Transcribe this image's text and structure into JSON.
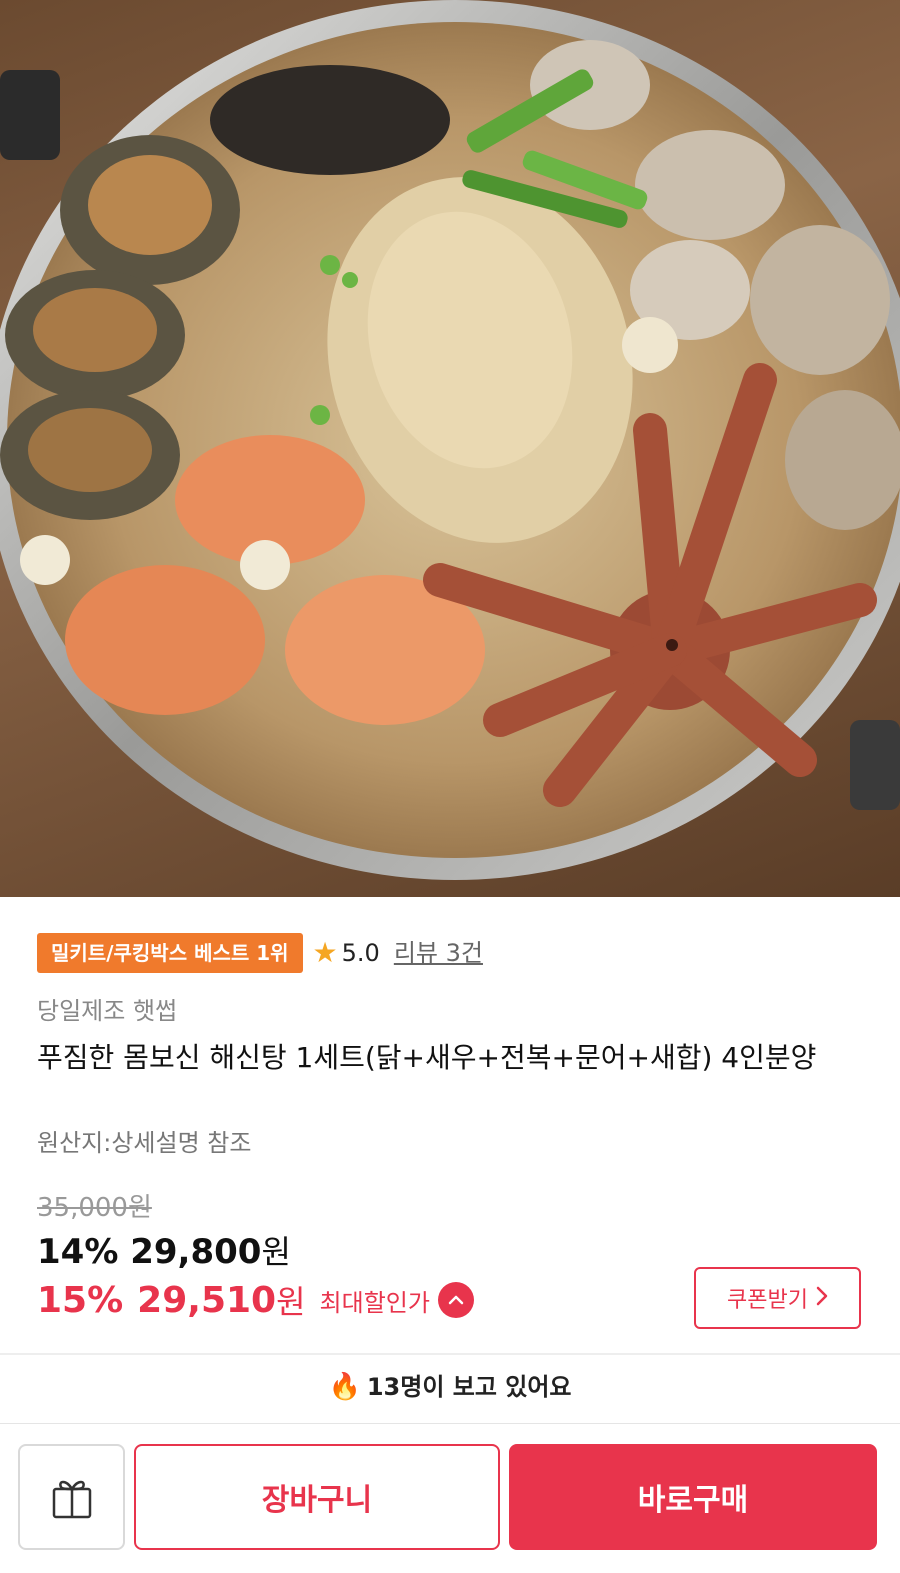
{
  "hero": {
    "image_description_icon": "seafood-hotpot-photo"
  },
  "product": {
    "best_badge": "밀키트/쿠킹박스 베스트 1위",
    "rating": "5.0",
    "review_link": "리뷰 3건",
    "brand": "당일제조 햇썹",
    "title": "푸짐한 몸보신 해신탕 1세트(닭+새우+전복+문어+새합) 4인분양",
    "origin": "원산지:상세설명 참조"
  },
  "price": {
    "original": "35,000원",
    "discount_percent": "14%",
    "discount_price": "29,800",
    "currency": "원",
    "max_discount_percent": "15%",
    "max_discount_price": "29,510",
    "max_discount_label": "최대할인가",
    "coupon_button": "쿠폰받기"
  },
  "viewers": {
    "text": "13명이 보고 있어요"
  },
  "bottom_bar": {
    "cart_label": "장바구니",
    "buy_label": "바로구매"
  },
  "colors": {
    "accent": "#e8344c",
    "badge": "#f07a2c",
    "star": "#f5a623"
  }
}
